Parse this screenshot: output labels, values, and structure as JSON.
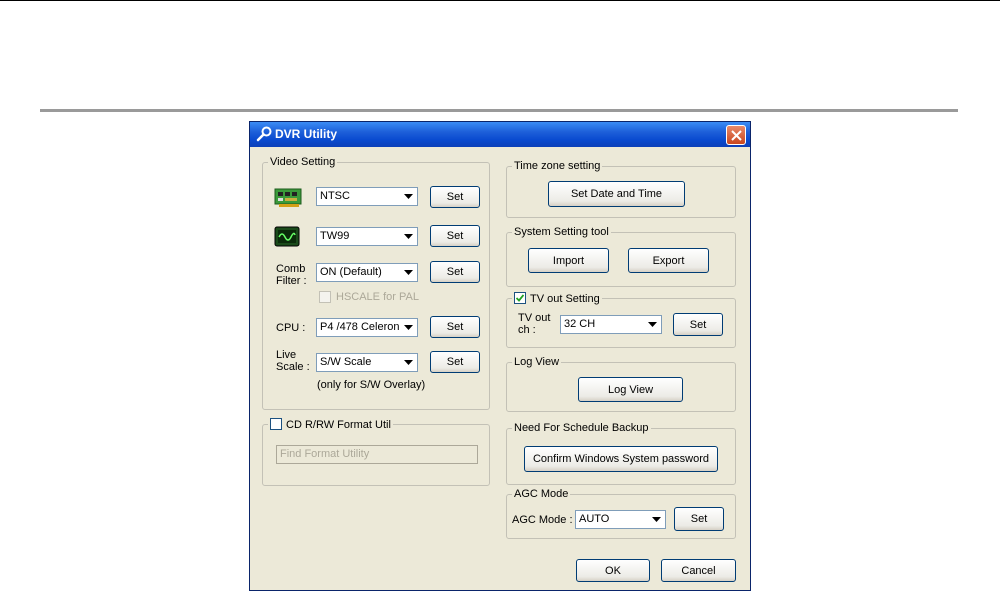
{
  "window": {
    "title": "DVR Utility"
  },
  "video_setting": {
    "legend": "Video Setting",
    "video_format": {
      "value": "NTSC",
      "set_label": "Set"
    },
    "chip": {
      "value": "TW99",
      "set_label": "Set"
    },
    "comb_filter": {
      "label_line1": "Comb",
      "label_line2": "Filter :",
      "value": "ON (Default)",
      "set_label": "Set"
    },
    "hscale": {
      "label": "HSCALE for PAL"
    },
    "cpu": {
      "label": "CPU :",
      "value": "P4 /478 Celeron",
      "set_label": "Set"
    },
    "live_scale": {
      "label_line1": "Live",
      "label_line2": "Scale :",
      "value": "S/W Scale",
      "set_label": "Set",
      "note": "(only for S/W Overlay)"
    }
  },
  "cd_format": {
    "legend": "CD R/RW Format Util",
    "placeholder": "Find Format Utility"
  },
  "time_zone": {
    "legend": "Time zone setting",
    "button": "Set Date and Time"
  },
  "system_tool": {
    "legend": "System Setting tool",
    "import": "Import",
    "export": "Export"
  },
  "tv_out": {
    "legend": "TV out Setting",
    "label_line1": "TV out",
    "label_line2": "ch :",
    "value": "32 CH",
    "set_label": "Set"
  },
  "log_view": {
    "legend": "Log View",
    "button": "Log View"
  },
  "schedule_backup": {
    "legend": "Need For Schedule Backup",
    "button": "Confirm Windows System password"
  },
  "agc": {
    "legend": "AGC Mode",
    "label": "AGC Mode :",
    "value": "AUTO",
    "set_label": "Set"
  },
  "footer": {
    "ok": "OK",
    "cancel": "Cancel"
  },
  "colors": {
    "titlebar": "#0a4bd0",
    "dialog_bg": "#ece9d8",
    "close_button": "#c9461f"
  }
}
